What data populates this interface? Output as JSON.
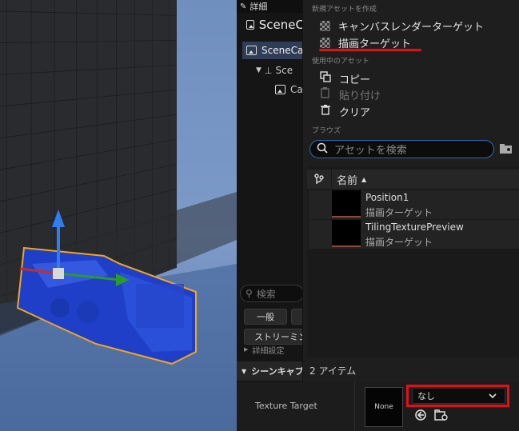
{
  "details": {
    "tab_label": "詳細",
    "component_title": "SceneC",
    "selected_item": "SceneCa",
    "tree_child": "Sce",
    "tree_grandchild": "Ca",
    "search_placeholder": "検索",
    "filter_general": "一般",
    "filter_streaming": "ストリーミン",
    "section_rendering": "詳細設定",
    "section_capture": "シーンキャプ"
  },
  "property": {
    "label": "Texture Target",
    "thumbnail_text": "None",
    "dropdown_value": "なし"
  },
  "popup": {
    "section_create": "新規アセットを作成",
    "create_items": [
      {
        "label": "キャンバスレンダーターゲット"
      },
      {
        "label": "描画ターゲット"
      }
    ],
    "section_current": "使用中のアセット",
    "current_items": [
      {
        "label": "コピー",
        "disabled": false
      },
      {
        "label": "貼り付け",
        "disabled": true
      },
      {
        "label": "クリア",
        "disabled": false
      }
    ],
    "section_browse": "ブラウズ",
    "search_placeholder": "アセットを検索",
    "column_name": "名前",
    "assets": [
      {
        "name": "Position1",
        "type": "描画ターゲット"
      },
      {
        "name": "TilingTexturePreview",
        "type": "描画ターゲット"
      }
    ],
    "item_count": "2 アイテム"
  },
  "colors": {
    "highlight_red": "#e0101a",
    "accent_blue": "#2a6cb0",
    "selection": "#2f3d57"
  }
}
